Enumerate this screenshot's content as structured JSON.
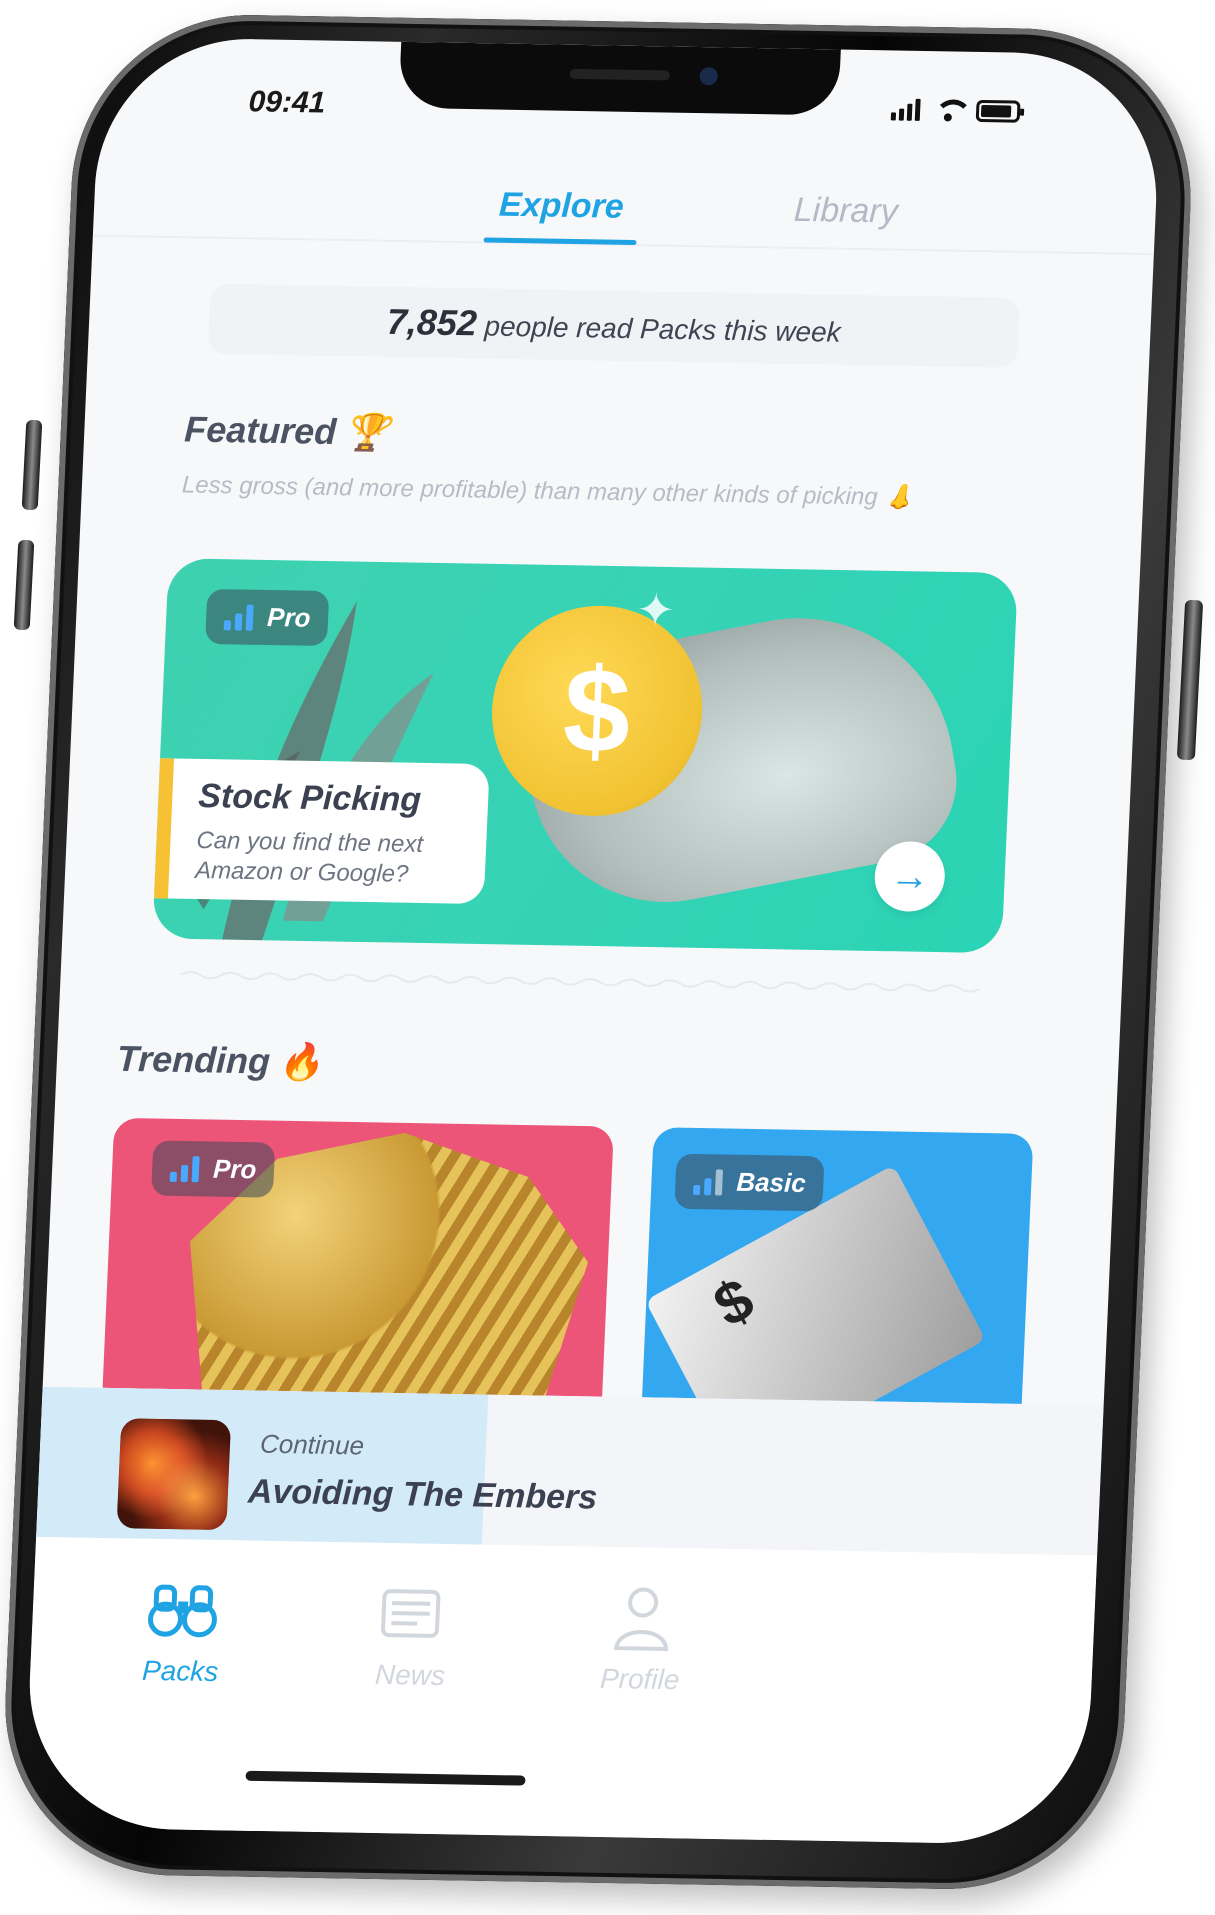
{
  "status": {
    "time": "09:41"
  },
  "tabs": [
    {
      "label": "Explore",
      "active": true
    },
    {
      "label": "Library",
      "active": false
    }
  ],
  "readers": {
    "count": "7,852",
    "text": "people read Packs this week"
  },
  "featured": {
    "title": "Featured",
    "emoji": "🏆",
    "subtitle": "Less gross (and more profitable) than many other kinds of picking 👃",
    "card": {
      "level": "Pro",
      "title": "Stock Picking",
      "description": "Can you find the next Amazon or Google?",
      "coin_symbol": "$",
      "accent_color": "#35d3b6"
    }
  },
  "trending": {
    "title": "Trending",
    "emoji": "🔥",
    "cards": [
      {
        "level": "Pro",
        "color": "#ec5578"
      },
      {
        "level": "Basic",
        "color": "#33a7f0"
      }
    ]
  },
  "continue": {
    "label": "Continue",
    "title": "Avoiding The Embers",
    "progress": 0.42
  },
  "nav": [
    {
      "label": "Packs",
      "icon": "binoculars-icon",
      "active": true
    },
    {
      "label": "News",
      "icon": "newspaper-icon",
      "active": false
    },
    {
      "label": "Profile",
      "icon": "person-icon",
      "active": false
    }
  ],
  "colors": {
    "accent": "#1fa3e3",
    "featured_stripe": "#f6c234"
  }
}
